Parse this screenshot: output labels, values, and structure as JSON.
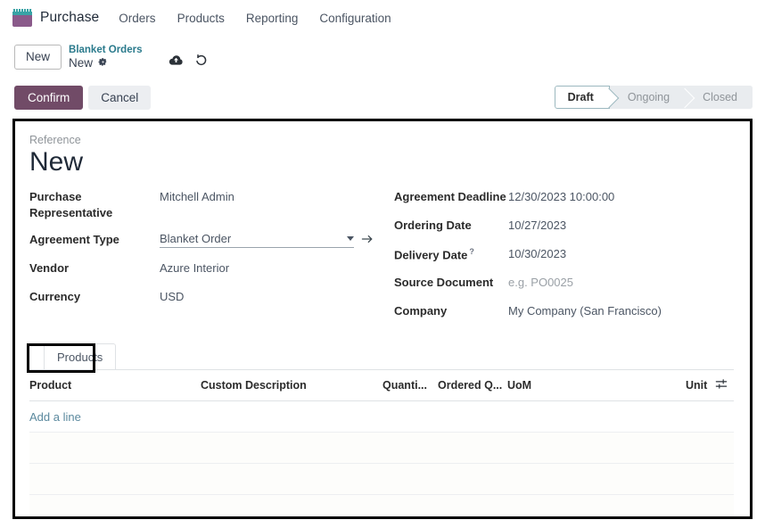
{
  "navbar": {
    "app_icon": "purchase-app-icon",
    "app_name": "Purchase",
    "menu_items": [
      {
        "label": "Orders"
      },
      {
        "label": "Products"
      },
      {
        "label": "Reporting"
      },
      {
        "label": "Configuration"
      }
    ]
  },
  "breadcrumb": {
    "new_button": "New",
    "parent": "Blanket Orders",
    "current": "New",
    "gear_icon": "gear-icon",
    "save_icon": "cloud-upload-icon",
    "discard_icon": "undo-icon"
  },
  "control_panel": {
    "confirm_label": "Confirm",
    "cancel_label": "Cancel",
    "statusbar": [
      {
        "label": "Draft",
        "active": true
      },
      {
        "label": "Ongoing",
        "active": false
      },
      {
        "label": "Closed",
        "active": false
      }
    ]
  },
  "form": {
    "reference_label": "Reference",
    "title": "New",
    "left_fields": [
      {
        "label": "Purchase Representative",
        "value": "Mitchell Admin"
      },
      {
        "label": "Agreement Type",
        "value": "Blanket Order"
      },
      {
        "label": "Vendor",
        "value": "Azure Interior"
      },
      {
        "label": "Currency",
        "value": "USD"
      }
    ],
    "right_fields": [
      {
        "label": "Agreement Deadline",
        "value": "12/30/2023 10:00:00"
      },
      {
        "label": "Ordering Date",
        "value": "10/27/2023"
      },
      {
        "label": "Delivery Date",
        "value": "10/30/2023",
        "tooltip_marker": "?"
      },
      {
        "label": "Source Document",
        "value": "e.g. PO0025",
        "is_placeholder": true
      },
      {
        "label": "Company",
        "value": "My Company (San Francisco)"
      }
    ],
    "agreement_type": {
      "value": "Blanket Order",
      "caret_icon": "chevron-down-icon",
      "internal_link_icon": "arrow-right-icon"
    }
  },
  "notebook": {
    "tabs": [
      {
        "label": "Products",
        "active": true
      }
    ]
  },
  "products_table": {
    "columns": [
      "Product",
      "Custom Description",
      "Quanti...",
      "Ordered Q...",
      "UoM",
      "Unit P..."
    ],
    "optional_columns_icon": "sliders-icon",
    "add_line_label": "Add a line",
    "rows": [],
    "empty_row_count": 3
  },
  "colors": {
    "primary": "#714b67",
    "link": "#2a7a8c",
    "add_line": "#5b899e",
    "app_icon_top": "#38a3a5",
    "app_icon_body": "#8a5a8a",
    "annotation": "#000000",
    "status_active_border": "#9cb8bf"
  }
}
